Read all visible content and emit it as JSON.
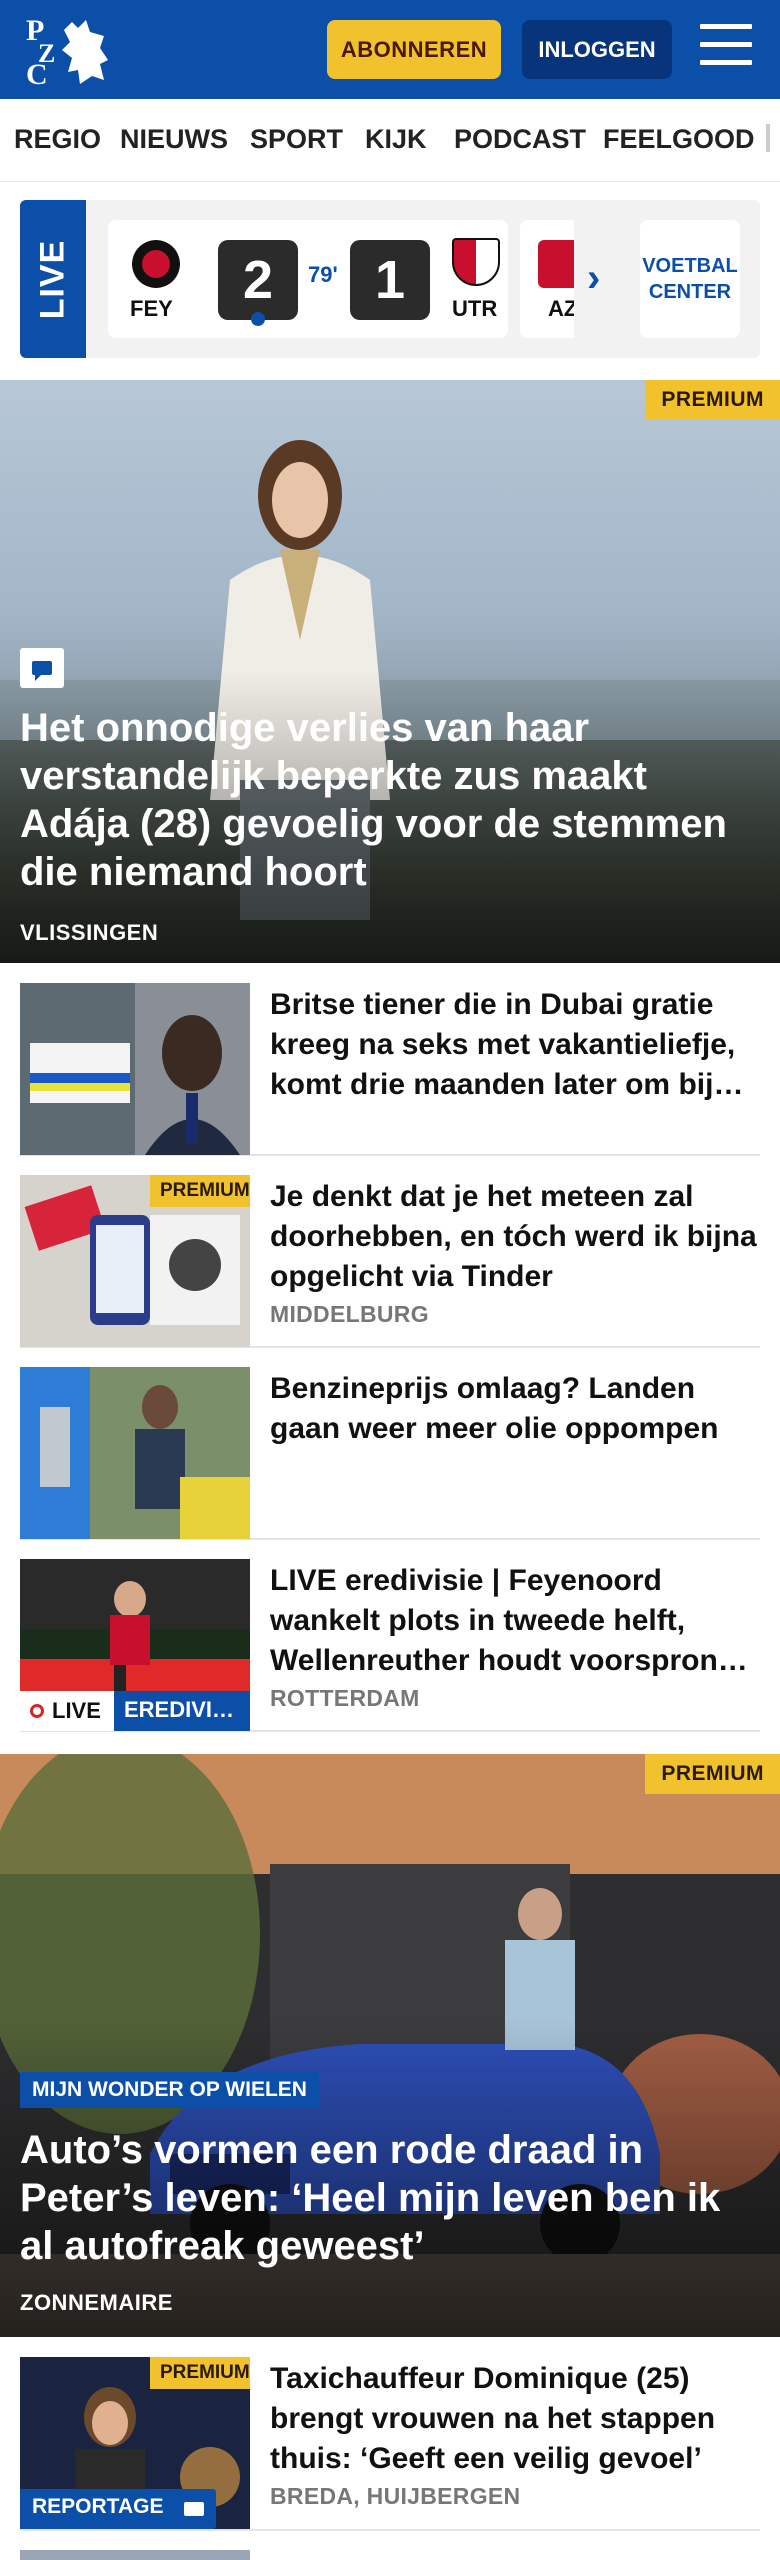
{
  "header": {
    "logo_text": "PZC",
    "subscribe_label": "ABONNEREN",
    "login_label": "INLOGGEN"
  },
  "nav": [
    "REGIO",
    "NIEUWS",
    "SPORT",
    "KIJK",
    "PODCAST",
    "FEELGOOD"
  ],
  "live": {
    "label": "LIVE",
    "match": {
      "home": "FEY",
      "home_score": "2",
      "minute": "79'",
      "away_score": "1",
      "away": "UTR"
    },
    "next_team": "AZ",
    "voetbal_center_line1": "VOETBAL",
    "voetbal_center_line2": "CENTER"
  },
  "hero1": {
    "badge": "PREMIUM",
    "title": "Het onnodige verlies van haar verstandelijk beperkte zus maakt Adája (28) gevoelig voor de stemmen die niemand hoort",
    "location": "VLISSINGEN"
  },
  "articles": [
    {
      "title": "Britse tiener die in Dubai gratie kreeg na seks met vakantieliefje, komt drie maanden later om bij…",
      "location": ""
    },
    {
      "title": "Je denkt dat je het meteen zal doorhebben, en tóch werd ik bijna opgelicht via Tinder",
      "location": "MIDDELBURG",
      "badge": "PREMIUM"
    },
    {
      "title": "Benzineprijs omlaag? Landen gaan weer meer olie oppompen",
      "location": ""
    },
    {
      "title": "LIVE eredivisie | Feyenoord wankelt plots in tweede helft, Wellenreuther houdt voorspron…",
      "location": "ROTTERDAM",
      "live_tag": "LIVE",
      "section_tag": "EREDIVI…"
    }
  ],
  "hero2": {
    "badge": "PREMIUM",
    "kicker": "MIJN WONDER OP WIELEN",
    "title": "Auto’s vormen een rode draad in Peter’s leven: ‘Heel mijn leven ben ik al autofreak geweest’",
    "location": "ZONNEMAIRE"
  },
  "article_last": {
    "badge": "PREMIUM",
    "tag": "REPORTAGE",
    "title": "Taxichauffeur Dominique (25) brengt vrouwen na het stappen thuis: ‘Geeft een veilig gevoel’",
    "location": "BREDA, HUIJBERGEN"
  },
  "colors": {
    "brand_blue": "#0b4fa8",
    "premium_yellow": "#f2c12e",
    "dark_blue": "#07347a"
  }
}
